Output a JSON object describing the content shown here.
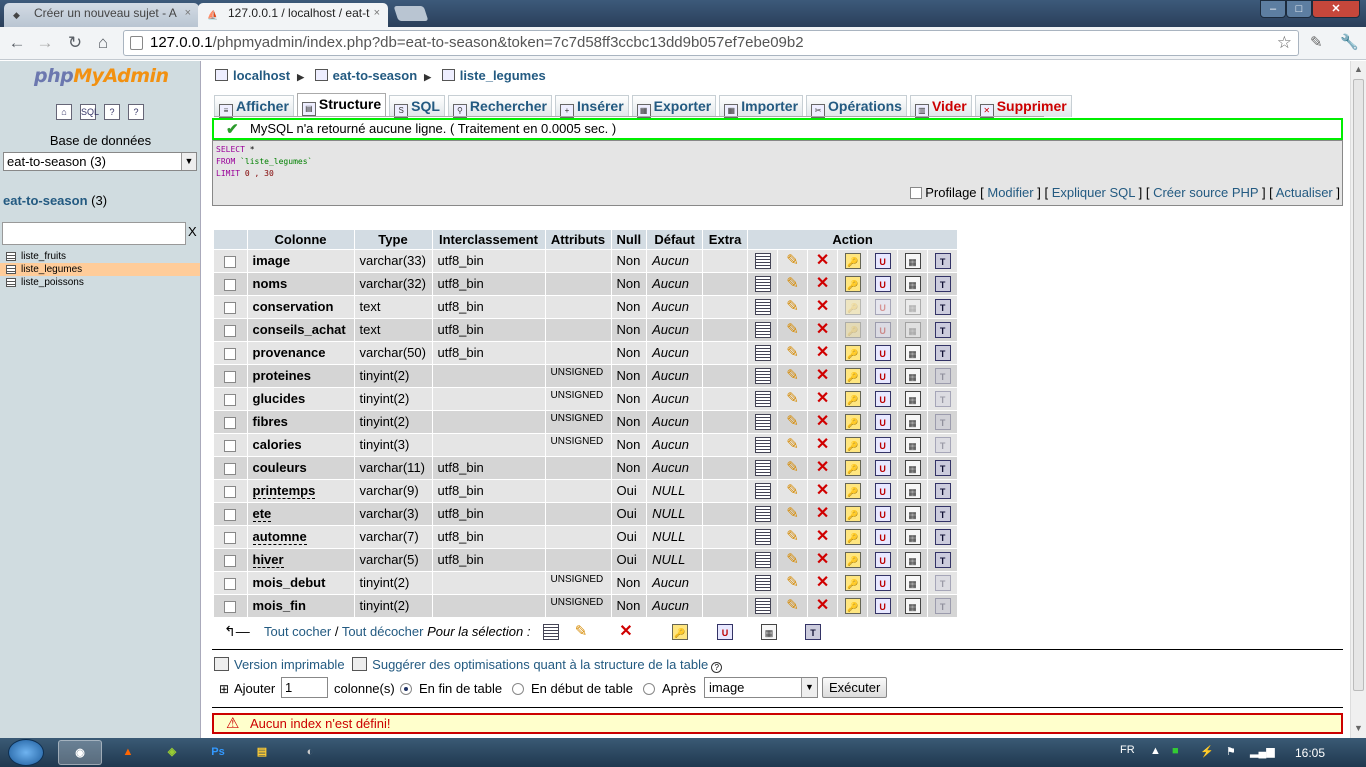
{
  "browser": {
    "tabs": [
      {
        "title": "Créer un nouveau sujet - A",
        "close": "×"
      },
      {
        "title": "127.0.0.1 / localhost / eat-t",
        "close": "×"
      }
    ],
    "window_controls": {
      "minimize": "–",
      "maximize": "□",
      "close": "✕"
    },
    "nav": {
      "back": "←",
      "forward": "→",
      "reload": "↻",
      "home": "⌂"
    },
    "url_host": "127.0.0.1",
    "url_rest": "/phpmyadmin/index.php?db=eat-to-season&token=7c7d58ff3ccbc13dd9b057ef7ebe09b2",
    "star": "☆"
  },
  "left": {
    "logo_php": "php",
    "logo_my": "MyAdmin",
    "icons": [
      "home-icon",
      "sql-icon",
      "query-icon",
      "docs-icon"
    ],
    "db_label": "Base de données",
    "db_select": "eat-to-season (3)",
    "db_link": "eat-to-season",
    "db_count": " (3)",
    "filter_clear": "X",
    "tables": [
      "liste_fruits",
      "liste_legumes",
      "liste_poissons"
    ],
    "selected_table": "liste_legumes"
  },
  "breadcrumb": [
    "localhost",
    "eat-to-season",
    "liste_legumes"
  ],
  "tabs": [
    {
      "label": "Afficher",
      "icon": "browse-icon"
    },
    {
      "label": "Structure",
      "icon": "structure-icon"
    },
    {
      "label": "SQL",
      "icon": "sql-icon"
    },
    {
      "label": "Rechercher",
      "icon": "search-icon"
    },
    {
      "label": "Insérer",
      "icon": "insert-icon"
    },
    {
      "label": "Exporter",
      "icon": "export-icon"
    },
    {
      "label": "Importer",
      "icon": "import-icon"
    },
    {
      "label": "Opérations",
      "icon": "operations-icon"
    },
    {
      "label": "Vider",
      "icon": "empty-icon"
    },
    {
      "label": "Supprimer",
      "icon": "drop-icon"
    }
  ],
  "active_tab": "Structure",
  "message": "MySQL n'a retourné aucune ligne. ( Traitement en 0.0005 sec. )",
  "sql": {
    "line1_kw": "SELECT",
    "line1_rest": " *",
    "line2_kw": "FROM",
    "line2_str": " `liste_legumes`",
    "line3_kw": "LIMIT",
    "line3_num": " 0 , 30"
  },
  "sql_links": {
    "profilage": "Profilage",
    "modifier": "Modifier",
    "expliquer": "Expliquer SQL",
    "creer": "Créer source PHP",
    "actualiser": "Actualiser"
  },
  "table": {
    "headers": [
      "Colonne",
      "Type",
      "Interclassement",
      "Attributs",
      "Null",
      "Défaut",
      "Extra",
      "Action"
    ],
    "rows": [
      {
        "name": "image",
        "type": "varchar(33)",
        "coll": "utf8_bin",
        "attr": "",
        "null": "Non",
        "def": "Aucun",
        "extra": "",
        "u": false
      },
      {
        "name": "noms",
        "type": "varchar(32)",
        "coll": "utf8_bin",
        "attr": "",
        "null": "Non",
        "def": "Aucun",
        "extra": "",
        "u": false
      },
      {
        "name": "conservation",
        "type": "text",
        "coll": "utf8_bin",
        "attr": "",
        "null": "Non",
        "def": "Aucun",
        "extra": "",
        "u": false
      },
      {
        "name": "conseils_achat",
        "type": "text",
        "coll": "utf8_bin",
        "attr": "",
        "null": "Non",
        "def": "Aucun",
        "extra": "",
        "u": false
      },
      {
        "name": "provenance",
        "type": "varchar(50)",
        "coll": "utf8_bin",
        "attr": "",
        "null": "Non",
        "def": "Aucun",
        "extra": "",
        "u": false
      },
      {
        "name": "proteines",
        "type": "tinyint(2)",
        "coll": "",
        "attr": "UNSIGNED",
        "null": "Non",
        "def": "Aucun",
        "extra": "",
        "u": false
      },
      {
        "name": "glucides",
        "type": "tinyint(2)",
        "coll": "",
        "attr": "UNSIGNED",
        "null": "Non",
        "def": "Aucun",
        "extra": "",
        "u": false
      },
      {
        "name": "fibres",
        "type": "tinyint(2)",
        "coll": "",
        "attr": "UNSIGNED",
        "null": "Non",
        "def": "Aucun",
        "extra": "",
        "u": false
      },
      {
        "name": "calories",
        "type": "tinyint(3)",
        "coll": "",
        "attr": "UNSIGNED",
        "null": "Non",
        "def": "Aucun",
        "extra": "",
        "u": false
      },
      {
        "name": "couleurs",
        "type": "varchar(11)",
        "coll": "utf8_bin",
        "attr": "",
        "null": "Non",
        "def": "Aucun",
        "extra": "",
        "u": false
      },
      {
        "name": "printemps",
        "type": "varchar(9)",
        "coll": "utf8_bin",
        "attr": "",
        "null": "Oui",
        "def": "NULL",
        "extra": "",
        "u": true
      },
      {
        "name": "ete",
        "type": "varchar(3)",
        "coll": "utf8_bin",
        "attr": "",
        "null": "Oui",
        "def": "NULL",
        "extra": "",
        "u": true
      },
      {
        "name": "automne",
        "type": "varchar(7)",
        "coll": "utf8_bin",
        "attr": "",
        "null": "Oui",
        "def": "NULL",
        "extra": "",
        "u": true
      },
      {
        "name": "hiver",
        "type": "varchar(5)",
        "coll": "utf8_bin",
        "attr": "",
        "null": "Oui",
        "def": "NULL",
        "extra": "",
        "u": true
      },
      {
        "name": "mois_debut",
        "type": "tinyint(2)",
        "coll": "",
        "attr": "UNSIGNED",
        "null": "Non",
        "def": "Aucun",
        "extra": "",
        "u": false
      },
      {
        "name": "mois_fin",
        "type": "tinyint(2)",
        "coll": "",
        "attr": "UNSIGNED",
        "null": "Non",
        "def": "Aucun",
        "extra": "",
        "u": false
      }
    ]
  },
  "selection": {
    "check_all": "Tout cocher",
    "sep": " / ",
    "uncheck_all": "Tout décocher",
    "for_selection": "Pour la sélection :"
  },
  "links": {
    "print": "Version imprimable",
    "suggest": "Suggérer des optimisations quant à la structure de la table"
  },
  "add": {
    "label": "Ajouter",
    "count": "1",
    "columns": "colonne(s)",
    "at_end": "En fin de table",
    "at_start": "En début de table",
    "after": "Après",
    "after_col": "image",
    "submit": "Exécuter"
  },
  "error": "Aucun index n'est défini!",
  "taskbar": {
    "lang": "FR",
    "clock": "16:05"
  }
}
